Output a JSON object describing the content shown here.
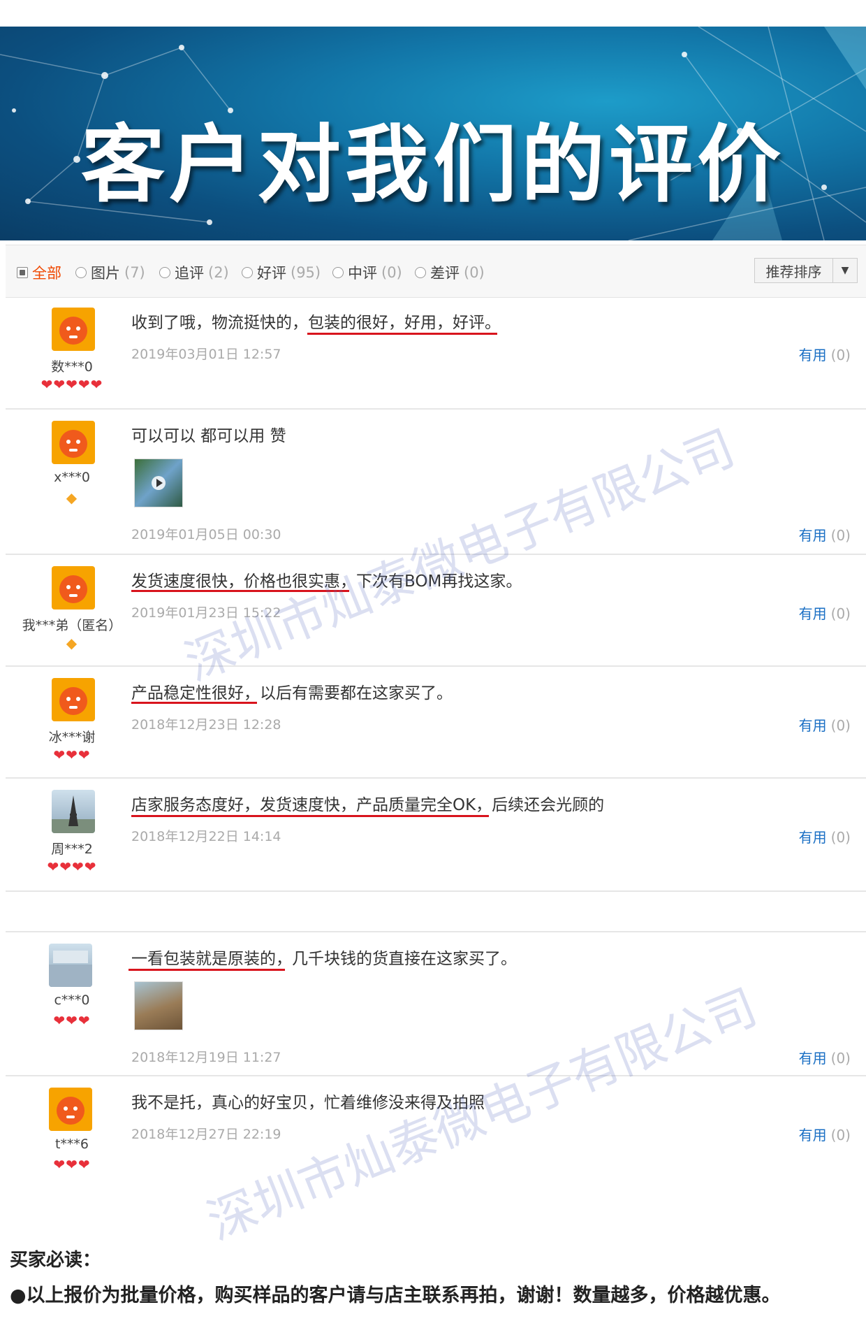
{
  "banner": {
    "title": "客户对我们的评价"
  },
  "filters": [
    {
      "label": "全部",
      "count": "",
      "active": true
    },
    {
      "label": "图片",
      "count": "(7)"
    },
    {
      "label": "追评",
      "count": "(2)"
    },
    {
      "label": "好评",
      "count": "(95)"
    },
    {
      "label": "中评",
      "count": "(0)"
    },
    {
      "label": "差评",
      "count": "(0)"
    }
  ],
  "sort": {
    "label": "推荐排序",
    "arrow": "▼"
  },
  "useful_label": "有用",
  "useful_count": "(0)",
  "reviews": [
    {
      "user": "数***0",
      "stars": "❤❤❤❤❤",
      "text": "收到了哦，物流挺快的，包装的很好，好用，好评。",
      "date": "2019年03月01日 12:57"
    },
    {
      "user": "x***0",
      "stars": "◆",
      "text": "可以可以 都可以用 赞",
      "date": "2019年01月05日 00:30"
    },
    {
      "user": "我***弟（匿名）",
      "stars": "◆",
      "text": "发货速度很快，价格也很实惠，下次有BOM再找这家。",
      "date": "2019年01月23日 15:22"
    },
    {
      "user": "冰***谢",
      "stars": "❤❤❤",
      "text": "产品稳定性很好，以后有需要都在这家买了。",
      "date": "2018年12月23日 12:28"
    },
    {
      "user": "周***2",
      "stars": "❤❤❤❤",
      "text": "店家服务态度好，发货速度快，产品质量完全OK，后续还会光顾的",
      "date": "2018年12月22日 14:14"
    },
    {
      "user": "c***0",
      "stars": "❤❤❤",
      "text": "一看包装就是原装的，几千块钱的货直接在这家买了。",
      "date": "2018年12月19日 11:27"
    },
    {
      "user": "t***6",
      "stars": "❤❤❤",
      "text": "我不是托，真心的好宝贝，忙着维修没来得及拍照",
      "date": "2018年12月27日 22:19"
    }
  ],
  "watermark": "深圳市灿泰微电子有限公司",
  "notice": {
    "title": "买家必读：",
    "text": "●以上报价为批量价格，购买样品的客户请与店主联系再拍，谢谢！数量越多，价格越优惠。"
  }
}
